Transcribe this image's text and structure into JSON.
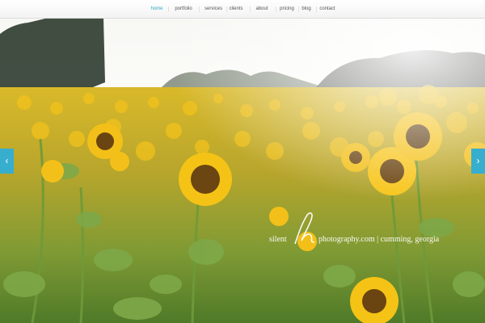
{
  "nav": {
    "items": [
      {
        "label": "home",
        "active": true
      },
      {
        "label": "portfolio",
        "active": false
      },
      {
        "label": "services",
        "active": false
      },
      {
        "label": "clients",
        "active": false
      },
      {
        "label": "about",
        "active": false
      },
      {
        "label": "pricing",
        "active": false
      },
      {
        "label": "blog",
        "active": false
      },
      {
        "label": "contact",
        "active": false
      }
    ],
    "active_color": "#33a9c9"
  },
  "slider": {
    "prev_icon": "chevron-left-icon",
    "next_icon": "chevron-right-icon",
    "arrow_color": "#37aece"
  },
  "hero": {
    "subject": "sunflower-field-photo",
    "watermark": {
      "left_text": "silent",
      "right_text": "photography.com | cumming, georgia"
    }
  }
}
